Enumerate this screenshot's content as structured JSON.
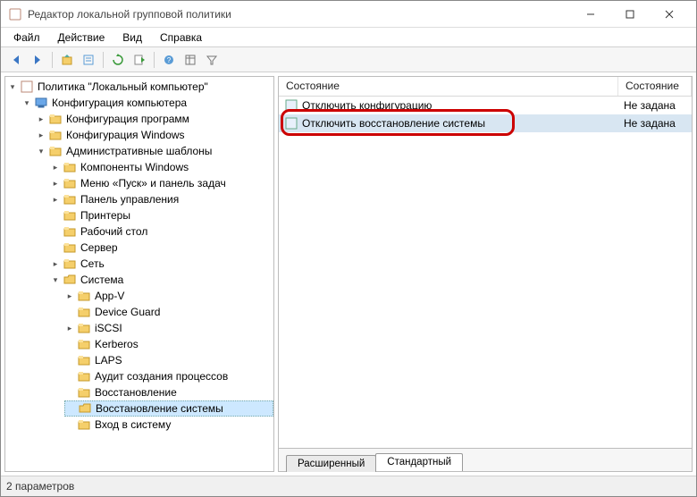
{
  "window": {
    "title": "Редактор локальной групповой политики"
  },
  "menu": {
    "file": "Файл",
    "action": "Действие",
    "view": "Вид",
    "help": "Справка"
  },
  "toolbar_icons": [
    "back",
    "forward",
    "up",
    "props",
    "refresh",
    "export",
    "help",
    "columns",
    "filter"
  ],
  "tree_root": "Политика \"Локальный компьютер\"",
  "tree": {
    "computer_cfg": "Конфигурация компьютера",
    "soft_cfg": "Конфигурация программ",
    "win_cfg": "Конфигурация Windows",
    "admin_tpl": "Административные шаблоны",
    "win_comp": "Компоненты Windows",
    "start_menu": "Меню «Пуск» и панель задач",
    "ctrl_panel": "Панель управления",
    "printers": "Принтеры",
    "desktop": "Рабочий стол",
    "server": "Сервер",
    "network": "Сеть",
    "system": "Система",
    "appv": "App-V",
    "dev_guard": "Device Guard",
    "iscsi": "iSCSI",
    "kerberos": "Kerberos",
    "laps": "LAPS",
    "audit": "Аудит создания процессов",
    "restore": "Восстановление",
    "sys_restore": "Восстановление системы",
    "logon": "Вход в систему"
  },
  "list": {
    "columns": {
      "state_title": "Состояние",
      "state": "Состояние"
    },
    "rows": [
      {
        "name": "Отключить конфигурацию",
        "state": "Не задана"
      },
      {
        "name": "Отключить восстановление системы",
        "state": "Не задана"
      }
    ]
  },
  "tabs": {
    "extended": "Расширенный",
    "standard": "Стандартный"
  },
  "status": "2 параметров",
  "highlight_row_index": 1
}
